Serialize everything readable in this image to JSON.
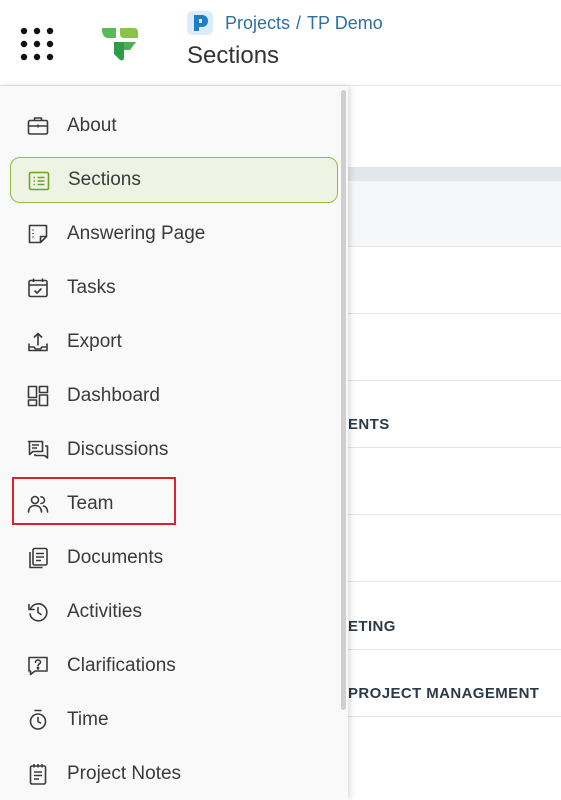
{
  "header": {
    "breadcrumb": {
      "projects": "Projects",
      "separator": "/",
      "project": "TP Demo"
    },
    "title": "Sections",
    "logo_color": "#4caf50",
    "badge_color": "#1f7fc4",
    "apps_icon": "apps-grid-icon"
  },
  "drawer": {
    "items": [
      {
        "label": "About",
        "icon": "briefcase-icon"
      },
      {
        "label": "Sections",
        "icon": "list-icon",
        "active": true
      },
      {
        "label": "Answering Page",
        "icon": "note-icon"
      },
      {
        "label": "Tasks",
        "icon": "calendar-check-icon"
      },
      {
        "label": "Export",
        "icon": "upload-icon"
      },
      {
        "label": "Dashboard",
        "icon": "dashboard-icon"
      },
      {
        "label": "Discussions",
        "icon": "chat-icon"
      },
      {
        "label": "Team",
        "icon": "users-icon",
        "highlighted": true
      },
      {
        "label": "Documents",
        "icon": "documents-icon"
      },
      {
        "label": "Activities",
        "icon": "history-icon"
      },
      {
        "label": "Clarifications",
        "icon": "question-chat-icon"
      },
      {
        "label": "Time",
        "icon": "stopwatch-icon"
      },
      {
        "label": "Project Notes",
        "icon": "notes-icon"
      }
    ],
    "active_color": "#8fbe3f",
    "highlight_color": "#d9232e"
  },
  "main": {
    "row_texts": [
      "",
      "",
      "ENTS",
      "",
      "",
      "ETING",
      "PROJECT MANAGEMENT"
    ]
  }
}
